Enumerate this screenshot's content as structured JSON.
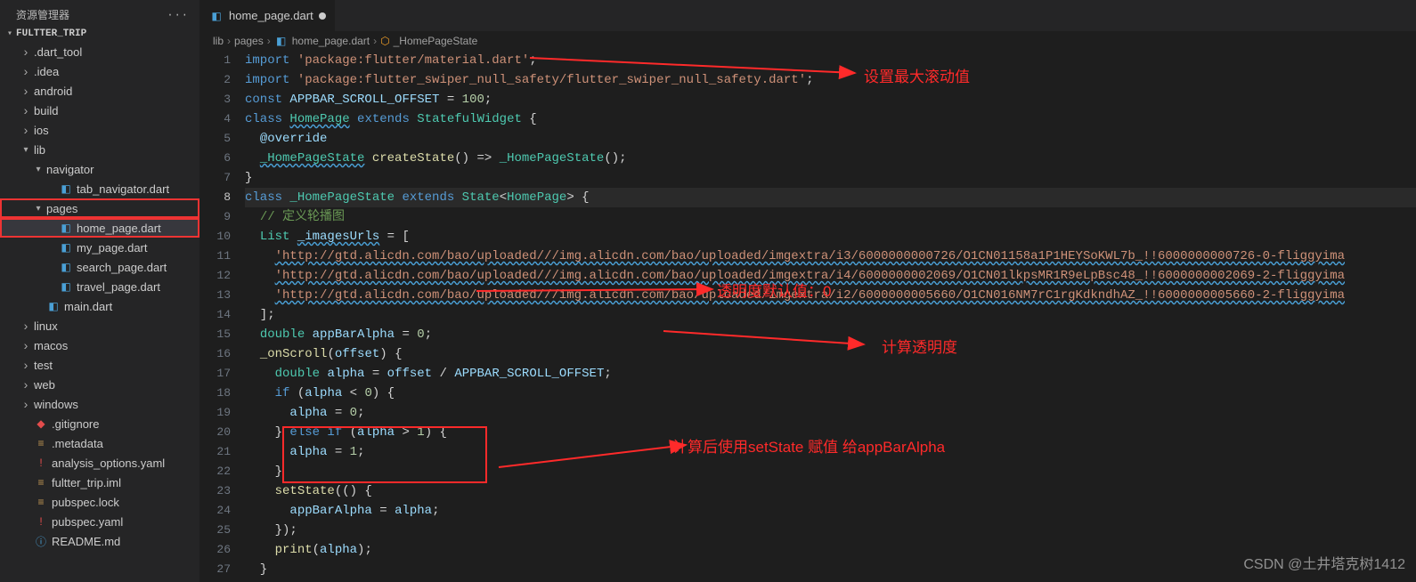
{
  "sidebar": {
    "title": "资源管理器",
    "project": "FULTTER_TRIP",
    "items": [
      {
        "label": ".dart_tool",
        "kind": "folder",
        "state": "collapsed",
        "indent": 1
      },
      {
        "label": ".idea",
        "kind": "folder",
        "state": "collapsed",
        "indent": 1
      },
      {
        "label": "android",
        "kind": "folder",
        "state": "collapsed",
        "indent": 1
      },
      {
        "label": "build",
        "kind": "folder",
        "state": "collapsed",
        "indent": 1
      },
      {
        "label": "ios",
        "kind": "folder",
        "state": "collapsed",
        "indent": 1
      },
      {
        "label": "lib",
        "kind": "folder",
        "state": "expanded",
        "indent": 1
      },
      {
        "label": "navigator",
        "kind": "folder",
        "state": "expanded",
        "indent": 2
      },
      {
        "label": "tab_navigator.dart",
        "kind": "dart",
        "state": "none",
        "indent": 3
      },
      {
        "label": "pages",
        "kind": "folder",
        "state": "expanded",
        "indent": 2,
        "highlighted": true
      },
      {
        "label": "home_page.dart",
        "kind": "dart",
        "state": "none",
        "indent": 3,
        "selected": true,
        "highlighted": true
      },
      {
        "label": "my_page.dart",
        "kind": "dart",
        "state": "none",
        "indent": 3
      },
      {
        "label": "search_page.dart",
        "kind": "dart",
        "state": "none",
        "indent": 3
      },
      {
        "label": "travel_page.dart",
        "kind": "dart",
        "state": "none",
        "indent": 3
      },
      {
        "label": "main.dart",
        "kind": "dart",
        "state": "none",
        "indent": 2
      },
      {
        "label": "linux",
        "kind": "folder",
        "state": "collapsed",
        "indent": 1
      },
      {
        "label": "macos",
        "kind": "folder",
        "state": "collapsed",
        "indent": 1
      },
      {
        "label": "test",
        "kind": "folder",
        "state": "collapsed",
        "indent": 1
      },
      {
        "label": "web",
        "kind": "folder",
        "state": "collapsed",
        "indent": 1
      },
      {
        "label": "windows",
        "kind": "folder",
        "state": "collapsed",
        "indent": 1
      },
      {
        "label": ".gitignore",
        "kind": "git",
        "state": "none",
        "indent": 1
      },
      {
        "label": ".metadata",
        "kind": "meta",
        "state": "none",
        "indent": 1
      },
      {
        "label": "analysis_options.yaml",
        "kind": "yaml",
        "state": "none",
        "indent": 1
      },
      {
        "label": "fultter_trip.iml",
        "kind": "meta",
        "state": "none",
        "indent": 1
      },
      {
        "label": "pubspec.lock",
        "kind": "meta",
        "state": "none",
        "indent": 1
      },
      {
        "label": "pubspec.yaml",
        "kind": "yaml",
        "state": "none",
        "indent": 1
      },
      {
        "label": "README.md",
        "kind": "info",
        "state": "none",
        "indent": 1
      }
    ]
  },
  "tab": {
    "filename": "home_page.dart"
  },
  "breadcrumbs": {
    "parts": [
      "lib",
      "pages",
      "home_page.dart",
      "_HomePageState"
    ]
  },
  "code": {
    "active_line": 8,
    "lines": [
      {
        "n": 1,
        "seg": [
          [
            "kw",
            "import "
          ],
          [
            "str",
            "'package:flutter/material.dart'"
          ],
          [
            "def",
            ";"
          ]
        ]
      },
      {
        "n": 2,
        "seg": [
          [
            "kw",
            "import "
          ],
          [
            "str",
            "'package:flutter_swiper_null_safety/flutter_swiper_null_safety.dart'"
          ],
          [
            "def",
            ";"
          ]
        ]
      },
      {
        "n": 3,
        "seg": [
          [
            "kw",
            "const "
          ],
          [
            "var",
            "APPBAR_SCROLL_OFFSET"
          ],
          [
            "def",
            " = "
          ],
          [
            "num",
            "100"
          ],
          [
            "def",
            ";"
          ]
        ]
      },
      {
        "n": 4,
        "seg": [
          [
            "kw",
            "class "
          ],
          [
            "cls squiggly",
            "HomePage"
          ],
          [
            "kw",
            " extends "
          ],
          [
            "cls",
            "StatefulWidget"
          ],
          [
            "def",
            " {"
          ]
        ]
      },
      {
        "n": 5,
        "seg": [
          [
            "def",
            "  "
          ],
          [
            "var",
            "@override"
          ]
        ]
      },
      {
        "n": 6,
        "seg": [
          [
            "def",
            "  "
          ],
          [
            "cls squiggly",
            "_HomePageState"
          ],
          [
            "def",
            " "
          ],
          [
            "fn",
            "createState"
          ],
          [
            "def",
            "() => "
          ],
          [
            "cls",
            "_HomePageState"
          ],
          [
            "def",
            "();"
          ]
        ]
      },
      {
        "n": 7,
        "seg": [
          [
            "def",
            "}"
          ]
        ]
      },
      {
        "n": 8,
        "seg": [
          [
            "kw",
            "class "
          ],
          [
            "cls",
            "_HomePageState"
          ],
          [
            "kw",
            " extends "
          ],
          [
            "cls",
            "State"
          ],
          [
            "def",
            "<"
          ],
          [
            "cls",
            "HomePage"
          ],
          [
            "def",
            "> {"
          ]
        ]
      },
      {
        "n": 9,
        "seg": [
          [
            "def",
            "  "
          ],
          [
            "cmt",
            "// 定义轮播图"
          ]
        ]
      },
      {
        "n": 10,
        "seg": [
          [
            "def",
            "  "
          ],
          [
            "cls",
            "List"
          ],
          [
            "def",
            " "
          ],
          [
            "var squiggly",
            "_imagesUrls"
          ],
          [
            "def",
            " = ["
          ]
        ]
      },
      {
        "n": 11,
        "seg": [
          [
            "def",
            "    "
          ],
          [
            "str squiggly",
            "'http://gtd.alicdn.com/bao/uploaded///img.alicdn.com/bao/uploaded/imgextra/i3/6000000000726/O1CN01158a1P1HEYSoKWL7b_!!6000000000726-0-fliggyima"
          ]
        ]
      },
      {
        "n": 12,
        "seg": [
          [
            "def",
            "    "
          ],
          [
            "str squiggly",
            "'http://gtd.alicdn.com/bao/uploaded///img.alicdn.com/bao/uploaded/imgextra/i4/6000000002069/O1CN01lkpsMR1R9eLpBsc48_!!6000000002069-2-fliggyima"
          ]
        ]
      },
      {
        "n": 13,
        "seg": [
          [
            "def",
            "    "
          ],
          [
            "str squiggly",
            "'http://gtd.alicdn.com/bao/uploaded///img.alicdn.com/bao/uploaded/imgextra/i2/6000000005660/O1CN016NM7rC1rgKdkndhAZ_!!6000000005660-2-fliggyima"
          ]
        ]
      },
      {
        "n": 14,
        "seg": [
          [
            "def",
            "  ];"
          ]
        ]
      },
      {
        "n": 15,
        "seg": [
          [
            "def",
            "  "
          ],
          [
            "cls",
            "double"
          ],
          [
            "def",
            " "
          ],
          [
            "var",
            "appBarAlpha"
          ],
          [
            "def",
            " = "
          ],
          [
            "num",
            "0"
          ],
          [
            "def",
            ";"
          ]
        ]
      },
      {
        "n": 16,
        "seg": [
          [
            "def",
            "  "
          ],
          [
            "fn",
            "_onScroll"
          ],
          [
            "def",
            "("
          ],
          [
            "var",
            "offset"
          ],
          [
            "def",
            ") {"
          ]
        ]
      },
      {
        "n": 17,
        "seg": [
          [
            "def",
            "    "
          ],
          [
            "cls",
            "double"
          ],
          [
            "def",
            " "
          ],
          [
            "var",
            "alpha"
          ],
          [
            "def",
            " = "
          ],
          [
            "var",
            "offset"
          ],
          [
            "def",
            " / "
          ],
          [
            "var",
            "APPBAR_SCROLL_OFFSET"
          ],
          [
            "def",
            ";"
          ]
        ]
      },
      {
        "n": 18,
        "seg": [
          [
            "def",
            "    "
          ],
          [
            "kw",
            "if"
          ],
          [
            "def",
            " ("
          ],
          [
            "var",
            "alpha"
          ],
          [
            "def",
            " < "
          ],
          [
            "num",
            "0"
          ],
          [
            "def",
            ") {"
          ]
        ]
      },
      {
        "n": 19,
        "seg": [
          [
            "def",
            "      "
          ],
          [
            "var",
            "alpha"
          ],
          [
            "def",
            " = "
          ],
          [
            "num",
            "0"
          ],
          [
            "def",
            ";"
          ]
        ]
      },
      {
        "n": 20,
        "seg": [
          [
            "def",
            "    } "
          ],
          [
            "kw",
            "else if"
          ],
          [
            "def",
            " ("
          ],
          [
            "var",
            "alpha"
          ],
          [
            "def",
            " > "
          ],
          [
            "num",
            "1"
          ],
          [
            "def",
            ") {"
          ]
        ]
      },
      {
        "n": 21,
        "seg": [
          [
            "def",
            "      "
          ],
          [
            "var",
            "alpha"
          ],
          [
            "def",
            " = "
          ],
          [
            "num",
            "1"
          ],
          [
            "def",
            ";"
          ]
        ]
      },
      {
        "n": 22,
        "seg": [
          [
            "def",
            "    }"
          ]
        ]
      },
      {
        "n": 23,
        "seg": [
          [
            "def",
            "    "
          ],
          [
            "fn",
            "setState"
          ],
          [
            "def",
            "(() {"
          ]
        ]
      },
      {
        "n": 24,
        "seg": [
          [
            "def",
            "      "
          ],
          [
            "var",
            "appBarAlpha"
          ],
          [
            "def",
            " = "
          ],
          [
            "var",
            "alpha"
          ],
          [
            "def",
            ";"
          ]
        ]
      },
      {
        "n": 25,
        "seg": [
          [
            "def",
            "    });"
          ]
        ]
      },
      {
        "n": 26,
        "seg": [
          [
            "def",
            "    "
          ],
          [
            "fn",
            "print"
          ],
          [
            "def",
            "("
          ],
          [
            "var",
            "alpha"
          ],
          [
            "def",
            ");"
          ]
        ]
      },
      {
        "n": 27,
        "seg": [
          [
            "def",
            "  }"
          ]
        ]
      }
    ]
  },
  "annotations": {
    "a1": "设置最大滚动值",
    "a2": "透明度默认值：0",
    "a3": "计算透明度",
    "a4": "计算后使用setState 赋值 给appBarAlpha"
  },
  "watermark": "CSDN @土井塔克树1412"
}
